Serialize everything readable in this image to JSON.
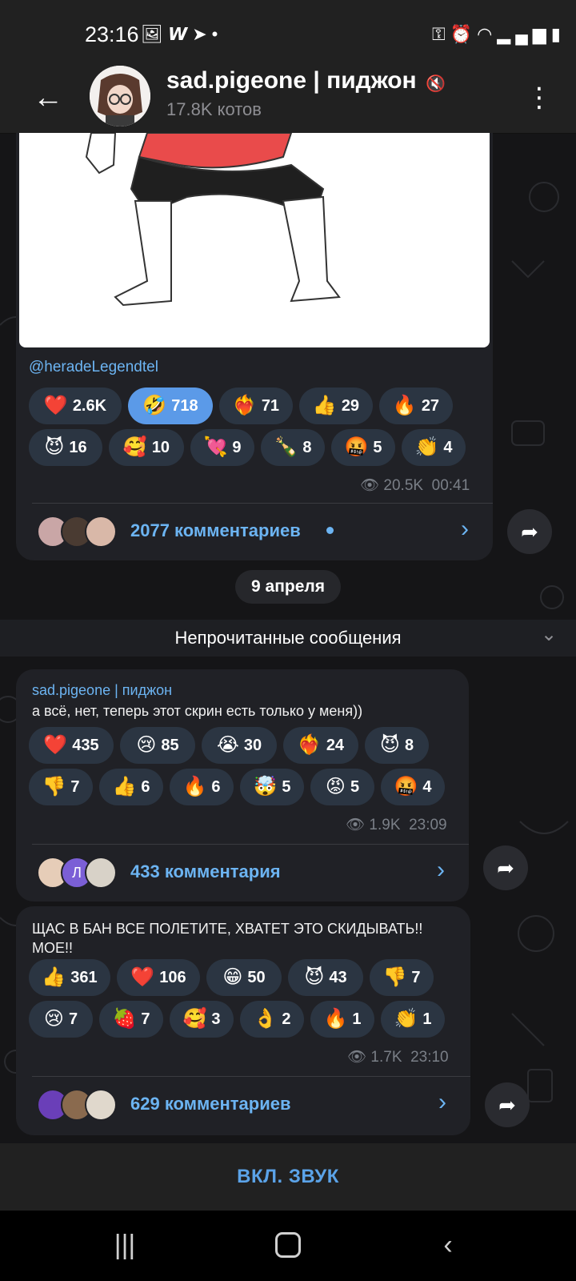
{
  "status_bar": {
    "time": "23:16",
    "left_icons": [
      "gallery-icon",
      "w-app-icon",
      "telegram-icon",
      "dot-icon"
    ],
    "right_icons": [
      "key-icon",
      "alarm-icon",
      "wifi-icon",
      "signal-icon",
      "battery-icon"
    ]
  },
  "header": {
    "title": "sad.pigeone | пиджон",
    "subtitle": "17.8K котов"
  },
  "post1": {
    "caption": "@heradeLegendtel",
    "reactions": [
      {
        "emoji": "❤️",
        "count": "2.6K"
      },
      {
        "emoji": "🤣",
        "count": "718",
        "active": true
      },
      {
        "emoji": "❤️‍🔥",
        "count": "71"
      },
      {
        "emoji": "👍",
        "count": "29"
      },
      {
        "emoji": "🔥",
        "count": "27"
      },
      {
        "emoji": "😈",
        "count": "16"
      },
      {
        "emoji": "🥰",
        "count": "10"
      },
      {
        "emoji": "💘",
        "count": "9"
      },
      {
        "emoji": "🍾",
        "count": "8"
      },
      {
        "emoji": "🤬",
        "count": "5"
      },
      {
        "emoji": "👏",
        "count": "4"
      }
    ],
    "views": "20.5K",
    "time": "00:41",
    "comments": "2077 комментариев"
  },
  "date_chip": "9 апреля",
  "unread_label": "Непрочитанные сообщения",
  "post2": {
    "sender": "sad.pigeone | пиджон",
    "text": "а всё, нет, теперь этот скрин есть только у меня))",
    "reactions": [
      {
        "emoji": "❤️",
        "count": "435"
      },
      {
        "emoji": "😢",
        "count": "85"
      },
      {
        "emoji": "😭",
        "count": "30"
      },
      {
        "emoji": "❤️‍🔥",
        "count": "24"
      },
      {
        "emoji": "😈",
        "count": "8"
      },
      {
        "emoji": "👎",
        "count": "7"
      },
      {
        "emoji": "👍",
        "count": "6"
      },
      {
        "emoji": "🔥",
        "count": "6"
      },
      {
        "emoji": "🤯",
        "count": "5"
      },
      {
        "emoji": "😡",
        "count": "5"
      },
      {
        "emoji": "🤬",
        "count": "4"
      }
    ],
    "views": "1.9K",
    "time": "23:09",
    "avatar_letter": "Л",
    "comments": "433 комментария"
  },
  "post3": {
    "text_line1": "ЩАС В БАН ВСЕ ПОЛЕТИТЕ, ХВАТЕТ ЭТО СКИДЫВАТЬ!!",
    "text_line2": "МОЕ!!",
    "reactions": [
      {
        "emoji": "👍",
        "count": "361"
      },
      {
        "emoji": "❤️",
        "count": "106"
      },
      {
        "emoji": "😁",
        "count": "50"
      },
      {
        "emoji": "😈",
        "count": "43"
      },
      {
        "emoji": "👎",
        "count": "7"
      },
      {
        "emoji": "😢",
        "count": "7"
      },
      {
        "emoji": "🍓",
        "count": "7"
      },
      {
        "emoji": "🥰",
        "count": "3"
      },
      {
        "emoji": "👌",
        "count": "2"
      },
      {
        "emoji": "🔥",
        "count": "1"
      },
      {
        "emoji": "👏",
        "count": "1"
      }
    ],
    "views": "1.7K",
    "time": "23:10",
    "comments": "629 комментариев"
  },
  "sound_button": "ВКЛ. ЗВУК",
  "colors": {
    "accent": "#6cb4f2",
    "bubble": "#202126",
    "reaction_bg": "#2b3542",
    "reaction_active": "#5b9ae8"
  }
}
